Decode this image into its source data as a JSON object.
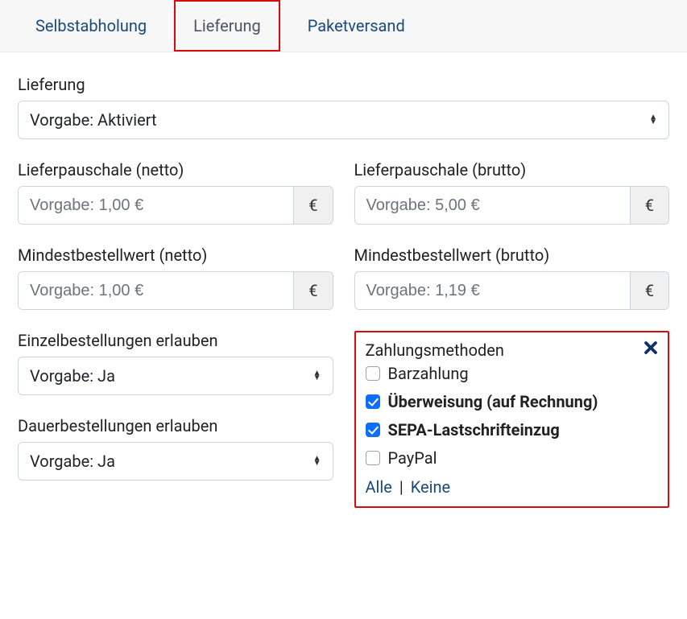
{
  "tabs": {
    "pickup": "Selbstabholung",
    "delivery": "Lieferung",
    "parcel": "Paketversand"
  },
  "delivery": {
    "status_label": "Lieferung",
    "status_value": "Vorgabe: Aktiviert",
    "fee_net": {
      "label": "Lieferpauschale (netto)",
      "placeholder": "Vorgabe: 1,00 €",
      "suffix": "€"
    },
    "fee_gross": {
      "label": "Lieferpauschale (brutto)",
      "placeholder": "Vorgabe: 5,00 €",
      "suffix": "€"
    },
    "min_net": {
      "label": "Mindestbestellwert (netto)",
      "placeholder": "Vorgabe: 1,00 €",
      "suffix": "€"
    },
    "min_gross": {
      "label": "Mindestbestellwert (brutto)",
      "placeholder": "Vorgabe: 1,19 €",
      "suffix": "€"
    },
    "single_orders": {
      "label": "Einzelbestellungen erlauben",
      "value": "Vorgabe: Ja"
    },
    "recurring_orders": {
      "label": "Dauerbestellungen erlauben",
      "value": "Vorgabe: Ja"
    }
  },
  "payments": {
    "title": "Zahlungsmethoden",
    "items": [
      {
        "label": "Barzahlung",
        "checked": false
      },
      {
        "label": "Überweisung (auf Rechnung)",
        "checked": true
      },
      {
        "label": "SEPA-Lastschrifteinzug",
        "checked": true
      },
      {
        "label": "PayPal",
        "checked": false
      }
    ],
    "all": "Alle",
    "none": "Keine"
  }
}
